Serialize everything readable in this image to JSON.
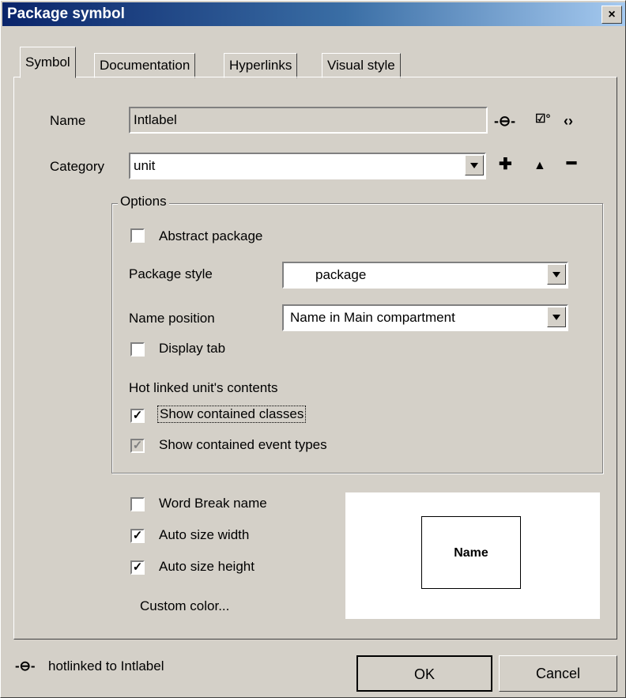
{
  "window": {
    "title": "Package symbol",
    "close_glyph": "×"
  },
  "tabs": [
    {
      "label": "Symbol",
      "active": true
    },
    {
      "label": "Documentation",
      "active": false
    },
    {
      "label": "Hyperlinks",
      "active": false
    },
    {
      "label": "Visual style",
      "active": false
    }
  ],
  "name": {
    "label": "Name",
    "value": "Intlabel"
  },
  "category": {
    "label": "Category",
    "value": "unit"
  },
  "options": {
    "group_label": "Options",
    "abstract_package": {
      "label": "Abstract package",
      "checked": false
    },
    "package_style": {
      "label": "Package style",
      "value": "package"
    },
    "name_position": {
      "label": "Name position",
      "value": "Name in Main compartment"
    },
    "display_tab": {
      "label": "Display tab",
      "checked": false
    },
    "hot_linked_label": "Hot linked unit's contents",
    "show_classes": {
      "label": "Show contained classes",
      "checked": true
    },
    "show_event_types": {
      "label": "Show contained event types",
      "checked": true,
      "disabled": true
    }
  },
  "word_break": {
    "label": "Word Break name",
    "checked": false
  },
  "auto_width": {
    "label": "Auto size width",
    "checked": true
  },
  "auto_height": {
    "label": "Auto size height",
    "checked": true
  },
  "custom_color": "Custom color...",
  "preview": {
    "name": "Name"
  },
  "status": {
    "text": "hotlinked to Intlabel"
  },
  "buttons": {
    "ok": "OK",
    "cancel": "Cancel"
  },
  "check_glyph": "✓"
}
